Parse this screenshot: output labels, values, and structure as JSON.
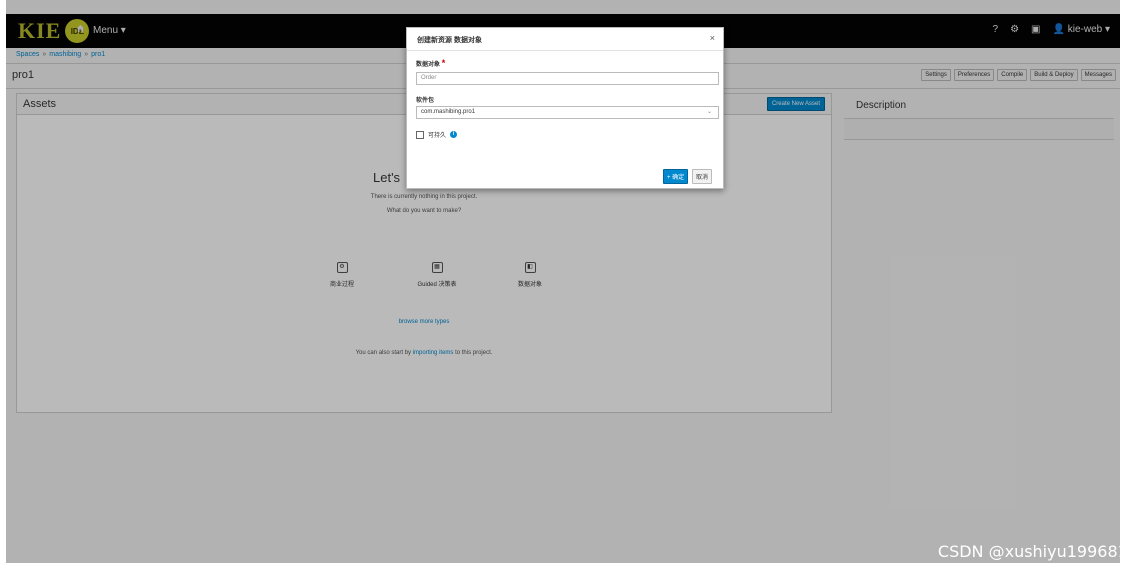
{
  "navbar": {
    "logo_text": "KIE",
    "logo_badge": "IDE",
    "home_icon": "home-icon",
    "menu_label": "Menu ▾",
    "help": "?",
    "settings": "⚙",
    "camera": "▣",
    "user": "kie-web ▾"
  },
  "breadcrumb": [
    "Spaces",
    "mashibing",
    "pro1"
  ],
  "page": {
    "title": "pro1"
  },
  "toolbar": [
    "Settings",
    "Preferences",
    "Compile",
    "Build & Deploy",
    "Messages"
  ],
  "assets": {
    "title": "Assets",
    "create_button": "Create New Asset",
    "empty_heading": "Let's",
    "empty_line1": "There is currently nothing in this project.",
    "empty_line2": "What do you want to make?",
    "types": [
      {
        "label": "商业过程",
        "icon": "process-icon"
      },
      {
        "label": "Guided 决策表",
        "icon": "decision-table-icon"
      },
      {
        "label": "数据对象",
        "icon": "data-object-icon"
      }
    ],
    "browse_more": "browse more types",
    "import_prefix": "You can also start by",
    "import_link": "importing items",
    "import_suffix": "to this project."
  },
  "description": {
    "title": "Description"
  },
  "modal": {
    "title": "创建新资源 数据对象",
    "close": "×",
    "data_object_label": "数据对象",
    "required_mark": "*",
    "data_object_value": "Order",
    "package_label": "软件包",
    "package_value": "com.mashibing.pro1",
    "persistable_label": "可持久",
    "ok_button": "+ 确定",
    "cancel_button": "取消"
  },
  "watermark": "CSDN @xushiyu1996818",
  "colors": {
    "accent": "#0088ce",
    "navbar": "#030303",
    "logo": "#c9cc2a"
  }
}
